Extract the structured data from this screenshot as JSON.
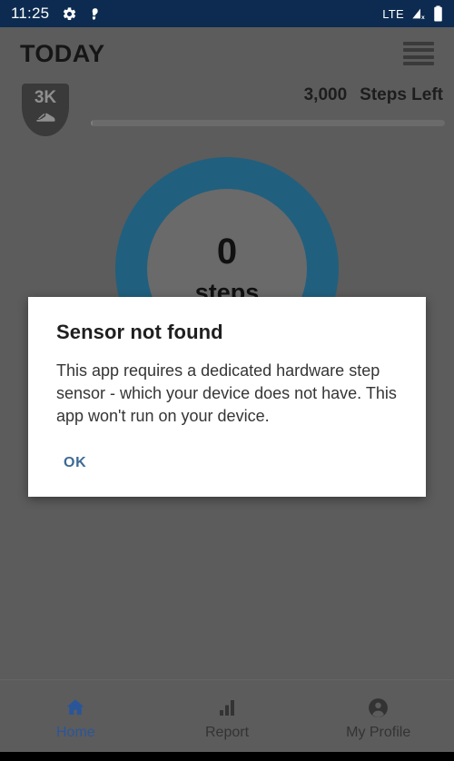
{
  "status_bar": {
    "clock": "11:25",
    "left_icons": [
      {
        "name": "gear-icon",
        "label": "settings"
      },
      {
        "name": "footprint-icon",
        "label": "step-tracker"
      }
    ],
    "network_label": "LTE",
    "right_icons": [
      {
        "name": "signal-no-service-icon",
        "label": "signal"
      },
      {
        "name": "battery-icon",
        "label": "battery"
      }
    ],
    "background_color": "#0d2b50"
  },
  "app_bar": {
    "title": "TODAY",
    "menu_icon": "hamburger-menu-icon",
    "background_color": "#5c5c5c"
  },
  "goal": {
    "badge_text": "3K",
    "badge_icon": "shoe-icon",
    "steps_left_value": "3,000",
    "steps_left_label": "Steps Left",
    "progress_percent": 0
  },
  "ring": {
    "value": "0",
    "unit": "steps",
    "ring_color": "#215f7e",
    "progress_percent": 0
  },
  "dialog": {
    "title": "Sensor not found",
    "message": "This app requires a dedicated hardware step sensor - which your device does not have. This app won't run on your device.",
    "ok_label": "OK",
    "accent_color": "#3d6a96"
  },
  "bottom_nav": {
    "active_color": "#2a5699",
    "inactive_color": "#333333",
    "items": [
      {
        "label": "Home",
        "icon": "home-icon",
        "active": true
      },
      {
        "label": "Report",
        "icon": "bar-chart-icon",
        "active": false
      },
      {
        "label": "My Profile",
        "icon": "person-circle-icon",
        "active": false
      }
    ]
  }
}
